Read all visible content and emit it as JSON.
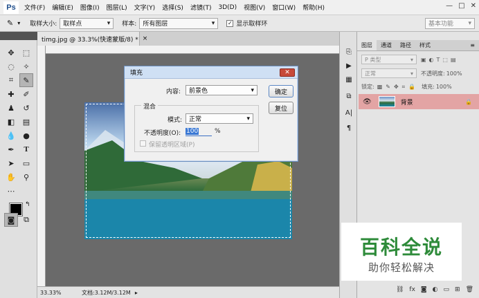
{
  "menubar": {
    "logo": "Ps",
    "items": [
      "文件(F)",
      "编辑(E)",
      "图像(I)",
      "图层(L)",
      "文字(Y)",
      "选择(S)",
      "滤镜(T)",
      "3D(D)",
      "视图(V)",
      "窗口(W)",
      "帮助(H)"
    ],
    "window_controls": [
      "—",
      "□",
      "✕"
    ]
  },
  "options": {
    "sample_size_label": "取样大小:",
    "sample_size_value": "取样点",
    "sample_label": "样本:",
    "sample_value": "所有图层",
    "show_ring_label": "显示取样环",
    "workspace": "基本功能"
  },
  "document": {
    "tab_title": "timg.jpg @ 33.3%(快速蒙版/8) *",
    "tab_close": "×",
    "zoom": "33.33%",
    "doc_info": "文档:3.12M/3.12M"
  },
  "dialog": {
    "title": "填充",
    "close": "✕",
    "content_label": "内容:",
    "content_value": "前景色",
    "ok": "确定",
    "reset": "复位",
    "blend_group": "混合",
    "mode_label": "模式:",
    "mode_value": "正常",
    "opacity_label": "不透明度(O):",
    "opacity_value": "100",
    "opacity_unit": "%",
    "preserve_label": "保留透明区域(P)"
  },
  "layers_panel": {
    "tabs": [
      "图层",
      "通道",
      "路径",
      "样式"
    ],
    "filter_kind": "P 类型",
    "blend_mode": "正常",
    "opacity_label": "不透明度:",
    "opacity_value": "100%",
    "lock_label": "锁定:",
    "fill_label": "填充:",
    "fill_value": "100%",
    "layer_name": "背景"
  },
  "watermark": {
    "title": "百科全说",
    "subtitle": "助你轻松解决"
  },
  "colors": {
    "layer_selected": "#e3a4a4",
    "watermark_green": "#2e8b3a"
  }
}
